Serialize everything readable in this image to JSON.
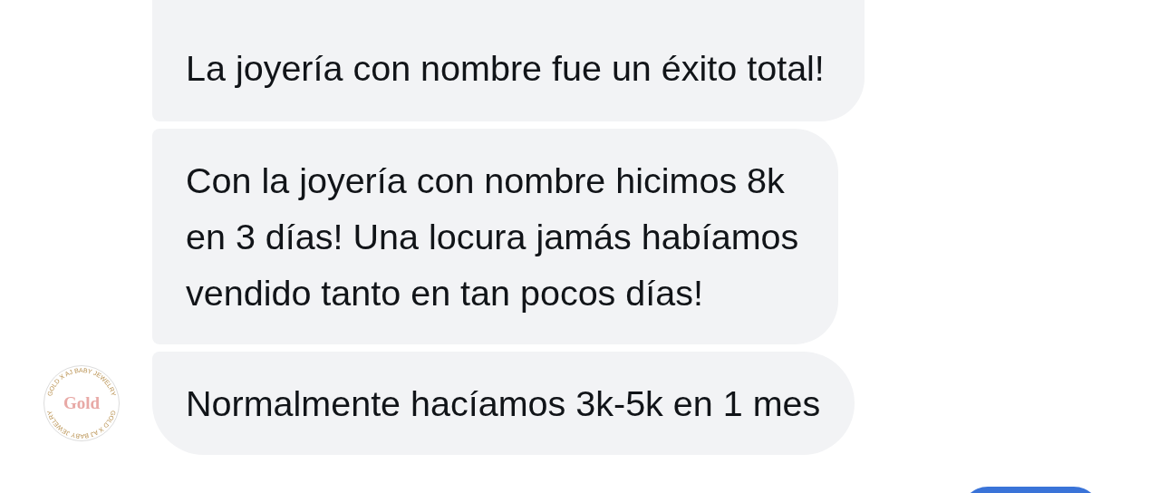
{
  "messages": [
    {
      "kind": "incoming",
      "lines": [
        "La joyería con nombre fue un éxito total!"
      ]
    },
    {
      "kind": "incoming",
      "lines": [
        "Con la joyería con nombre hicimos 8k",
        "en 3 días! Una locura jamás habíamos",
        "vendido tanto en tan pocos días!"
      ]
    },
    {
      "kind": "incoming",
      "lines": [
        "Normalmente hacíamos 3k-5k en 1 mes"
      ],
      "avatar": {
        "name": "Gold",
        "ring_texts": [
          "GOLD X AJ BABY JEWELRY",
          "GOLD X AJ BABY JEWELRY"
        ]
      }
    },
    {
      "kind": "outgoing"
    }
  ]
}
